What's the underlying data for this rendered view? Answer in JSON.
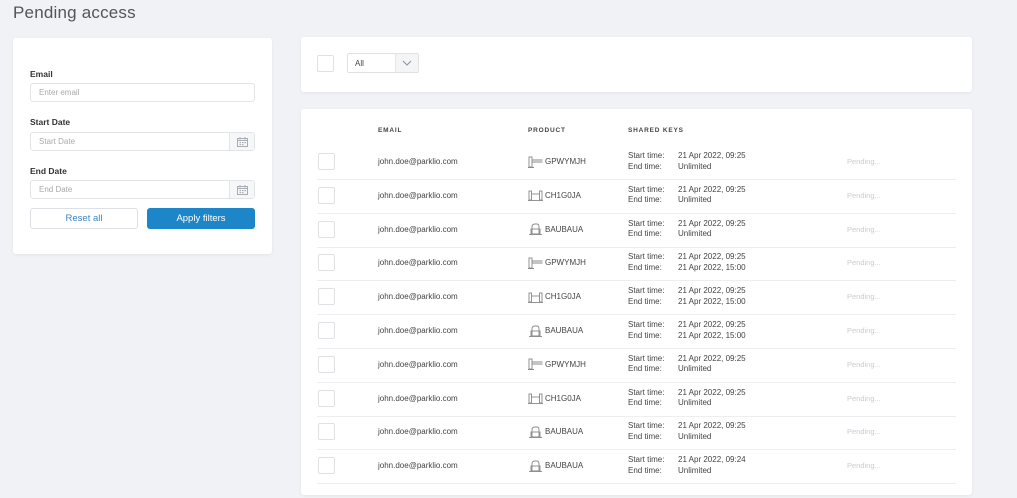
{
  "page": {
    "title": "Pending access"
  },
  "filters": {
    "email_label": "Email",
    "email_placeholder": "Enter email",
    "start_label": "Start Date",
    "start_placeholder": "Start Date",
    "end_label": "End Date",
    "end_placeholder": "End Date",
    "reset_label": "Reset all",
    "apply_label": "Apply filters"
  },
  "toolbar": {
    "select_value": "All"
  },
  "table": {
    "headers": {
      "email": "EMAIL",
      "product": "PRODUCT",
      "shared_keys": "SHARED KEYS"
    },
    "start_label": "Start time:",
    "end_label": "End time:",
    "rows": [
      {
        "email": "john.doe@parklio.com",
        "product_icon": "barrier-icon",
        "product": "GPWYMJH",
        "start": "21 Apr 2022, 09:25",
        "end": "Unlimited",
        "status": "Pending..."
      },
      {
        "email": "john.doe@parklio.com",
        "product_icon": "gate-icon",
        "product": "CH1G0JA",
        "start": "21 Apr 2022, 09:25",
        "end": "Unlimited",
        "status": "Pending..."
      },
      {
        "email": "john.doe@parklio.com",
        "product_icon": "lock-icon",
        "product": "BAUBAUA",
        "start": "21 Apr 2022, 09:25",
        "end": "Unlimited",
        "status": "Pending..."
      },
      {
        "email": "john.doe@parklio.com",
        "product_icon": "barrier-icon",
        "product": "GPWYMJH",
        "start": "21 Apr 2022, 09:25",
        "end": "21 Apr 2022, 15:00",
        "status": "Pending..."
      },
      {
        "email": "john.doe@parklio.com",
        "product_icon": "gate-icon",
        "product": "CH1G0JA",
        "start": "21 Apr 2022, 09:25",
        "end": "21 Apr 2022, 15:00",
        "status": "Pending..."
      },
      {
        "email": "john.doe@parklio.com",
        "product_icon": "lock-icon",
        "product": "BAUBAUA",
        "start": "21 Apr 2022, 09:25",
        "end": "21 Apr 2022, 15:00",
        "status": "Pending..."
      },
      {
        "email": "john.doe@parklio.com",
        "product_icon": "barrier-icon",
        "product": "GPWYMJH",
        "start": "21 Apr 2022, 09:25",
        "end": "Unlimited",
        "status": "Pending..."
      },
      {
        "email": "john.doe@parklio.com",
        "product_icon": "gate-icon",
        "product": "CH1G0JA",
        "start": "21 Apr 2022, 09:25",
        "end": "Unlimited",
        "status": "Pending..."
      },
      {
        "email": "john.doe@parklio.com",
        "product_icon": "lock-icon",
        "product": "BAUBAUA",
        "start": "21 Apr 2022, 09:25",
        "end": "Unlimited",
        "status": "Pending..."
      },
      {
        "email": "john.doe@parklio.com",
        "product_icon": "lock-icon",
        "product": "BAUBAUA",
        "start": "21 Apr 2022, 09:24",
        "end": "Unlimited",
        "status": "Pending..."
      }
    ]
  },
  "colors": {
    "primary": "#1c86c8",
    "background": "#f1f2f5",
    "pending": "#c9ccd1"
  }
}
